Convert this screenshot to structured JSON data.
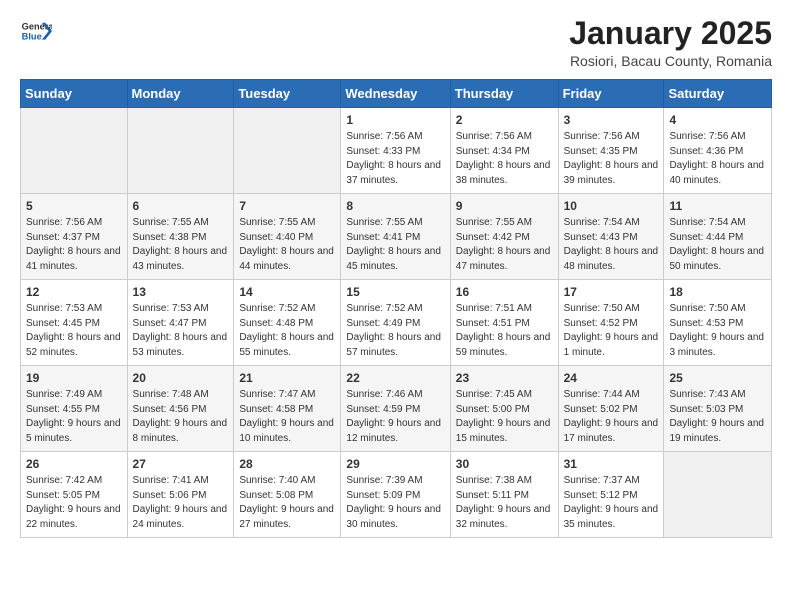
{
  "header": {
    "logo_general": "General",
    "logo_blue": "Blue",
    "month": "January 2025",
    "location": "Rosiori, Bacau County, Romania"
  },
  "weekdays": [
    "Sunday",
    "Monday",
    "Tuesday",
    "Wednesday",
    "Thursday",
    "Friday",
    "Saturday"
  ],
  "weeks": [
    [
      {
        "day": "",
        "info": ""
      },
      {
        "day": "",
        "info": ""
      },
      {
        "day": "",
        "info": ""
      },
      {
        "day": "1",
        "info": "Sunrise: 7:56 AM\nSunset: 4:33 PM\nDaylight: 8 hours and 37 minutes."
      },
      {
        "day": "2",
        "info": "Sunrise: 7:56 AM\nSunset: 4:34 PM\nDaylight: 8 hours and 38 minutes."
      },
      {
        "day": "3",
        "info": "Sunrise: 7:56 AM\nSunset: 4:35 PM\nDaylight: 8 hours and 39 minutes."
      },
      {
        "day": "4",
        "info": "Sunrise: 7:56 AM\nSunset: 4:36 PM\nDaylight: 8 hours and 40 minutes."
      }
    ],
    [
      {
        "day": "5",
        "info": "Sunrise: 7:56 AM\nSunset: 4:37 PM\nDaylight: 8 hours and 41 minutes."
      },
      {
        "day": "6",
        "info": "Sunrise: 7:55 AM\nSunset: 4:38 PM\nDaylight: 8 hours and 43 minutes."
      },
      {
        "day": "7",
        "info": "Sunrise: 7:55 AM\nSunset: 4:40 PM\nDaylight: 8 hours and 44 minutes."
      },
      {
        "day": "8",
        "info": "Sunrise: 7:55 AM\nSunset: 4:41 PM\nDaylight: 8 hours and 45 minutes."
      },
      {
        "day": "9",
        "info": "Sunrise: 7:55 AM\nSunset: 4:42 PM\nDaylight: 8 hours and 47 minutes."
      },
      {
        "day": "10",
        "info": "Sunrise: 7:54 AM\nSunset: 4:43 PM\nDaylight: 8 hours and 48 minutes."
      },
      {
        "day": "11",
        "info": "Sunrise: 7:54 AM\nSunset: 4:44 PM\nDaylight: 8 hours and 50 minutes."
      }
    ],
    [
      {
        "day": "12",
        "info": "Sunrise: 7:53 AM\nSunset: 4:45 PM\nDaylight: 8 hours and 52 minutes."
      },
      {
        "day": "13",
        "info": "Sunrise: 7:53 AM\nSunset: 4:47 PM\nDaylight: 8 hours and 53 minutes."
      },
      {
        "day": "14",
        "info": "Sunrise: 7:52 AM\nSunset: 4:48 PM\nDaylight: 8 hours and 55 minutes."
      },
      {
        "day": "15",
        "info": "Sunrise: 7:52 AM\nSunset: 4:49 PM\nDaylight: 8 hours and 57 minutes."
      },
      {
        "day": "16",
        "info": "Sunrise: 7:51 AM\nSunset: 4:51 PM\nDaylight: 8 hours and 59 minutes."
      },
      {
        "day": "17",
        "info": "Sunrise: 7:50 AM\nSunset: 4:52 PM\nDaylight: 9 hours and 1 minute."
      },
      {
        "day": "18",
        "info": "Sunrise: 7:50 AM\nSunset: 4:53 PM\nDaylight: 9 hours and 3 minutes."
      }
    ],
    [
      {
        "day": "19",
        "info": "Sunrise: 7:49 AM\nSunset: 4:55 PM\nDaylight: 9 hours and 5 minutes."
      },
      {
        "day": "20",
        "info": "Sunrise: 7:48 AM\nSunset: 4:56 PM\nDaylight: 9 hours and 8 minutes."
      },
      {
        "day": "21",
        "info": "Sunrise: 7:47 AM\nSunset: 4:58 PM\nDaylight: 9 hours and 10 minutes."
      },
      {
        "day": "22",
        "info": "Sunrise: 7:46 AM\nSunset: 4:59 PM\nDaylight: 9 hours and 12 minutes."
      },
      {
        "day": "23",
        "info": "Sunrise: 7:45 AM\nSunset: 5:00 PM\nDaylight: 9 hours and 15 minutes."
      },
      {
        "day": "24",
        "info": "Sunrise: 7:44 AM\nSunset: 5:02 PM\nDaylight: 9 hours and 17 minutes."
      },
      {
        "day": "25",
        "info": "Sunrise: 7:43 AM\nSunset: 5:03 PM\nDaylight: 9 hours and 19 minutes."
      }
    ],
    [
      {
        "day": "26",
        "info": "Sunrise: 7:42 AM\nSunset: 5:05 PM\nDaylight: 9 hours and 22 minutes."
      },
      {
        "day": "27",
        "info": "Sunrise: 7:41 AM\nSunset: 5:06 PM\nDaylight: 9 hours and 24 minutes."
      },
      {
        "day": "28",
        "info": "Sunrise: 7:40 AM\nSunset: 5:08 PM\nDaylight: 9 hours and 27 minutes."
      },
      {
        "day": "29",
        "info": "Sunrise: 7:39 AM\nSunset: 5:09 PM\nDaylight: 9 hours and 30 minutes."
      },
      {
        "day": "30",
        "info": "Sunrise: 7:38 AM\nSunset: 5:11 PM\nDaylight: 9 hours and 32 minutes."
      },
      {
        "day": "31",
        "info": "Sunrise: 7:37 AM\nSunset: 5:12 PM\nDaylight: 9 hours and 35 minutes."
      },
      {
        "day": "",
        "info": ""
      }
    ]
  ]
}
